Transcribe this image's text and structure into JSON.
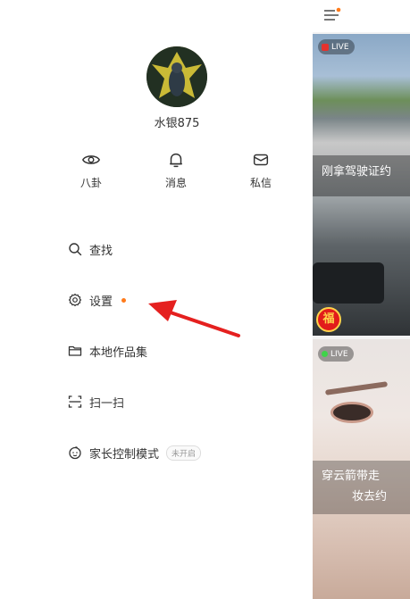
{
  "profile": {
    "username": "水银875"
  },
  "quick_actions": [
    {
      "label": "八卦",
      "icon": "eye-icon"
    },
    {
      "label": "消息",
      "icon": "bell-icon"
    },
    {
      "label": "私信",
      "icon": "mail-icon"
    }
  ],
  "menu": [
    {
      "label": "查找",
      "icon": "search-icon"
    },
    {
      "label": "设置",
      "icon": "settings-gear-icon",
      "has_dot": true
    },
    {
      "label": "本地作品集",
      "icon": "folder-icon"
    },
    {
      "label": "扫一扫",
      "icon": "scan-icon"
    },
    {
      "label": "家长控制模式",
      "icon": "child-face-icon",
      "badge": "未开启"
    }
  ],
  "feed": {
    "menu_icon": "hamburger-menu-icon",
    "cards": [
      {
        "live_label": "LIVE",
        "caption": "刚拿驾驶证约",
        "badge_char": "福"
      },
      {
        "live_label": "LIVE",
        "caption_line1": "穿云箭带走",
        "caption_line2": "妆去约"
      }
    ]
  },
  "colors": {
    "accent": "#ff7a1a",
    "arrow": "#e5201f",
    "live_red": "#e5322d",
    "live_green": "#3fd34a"
  }
}
